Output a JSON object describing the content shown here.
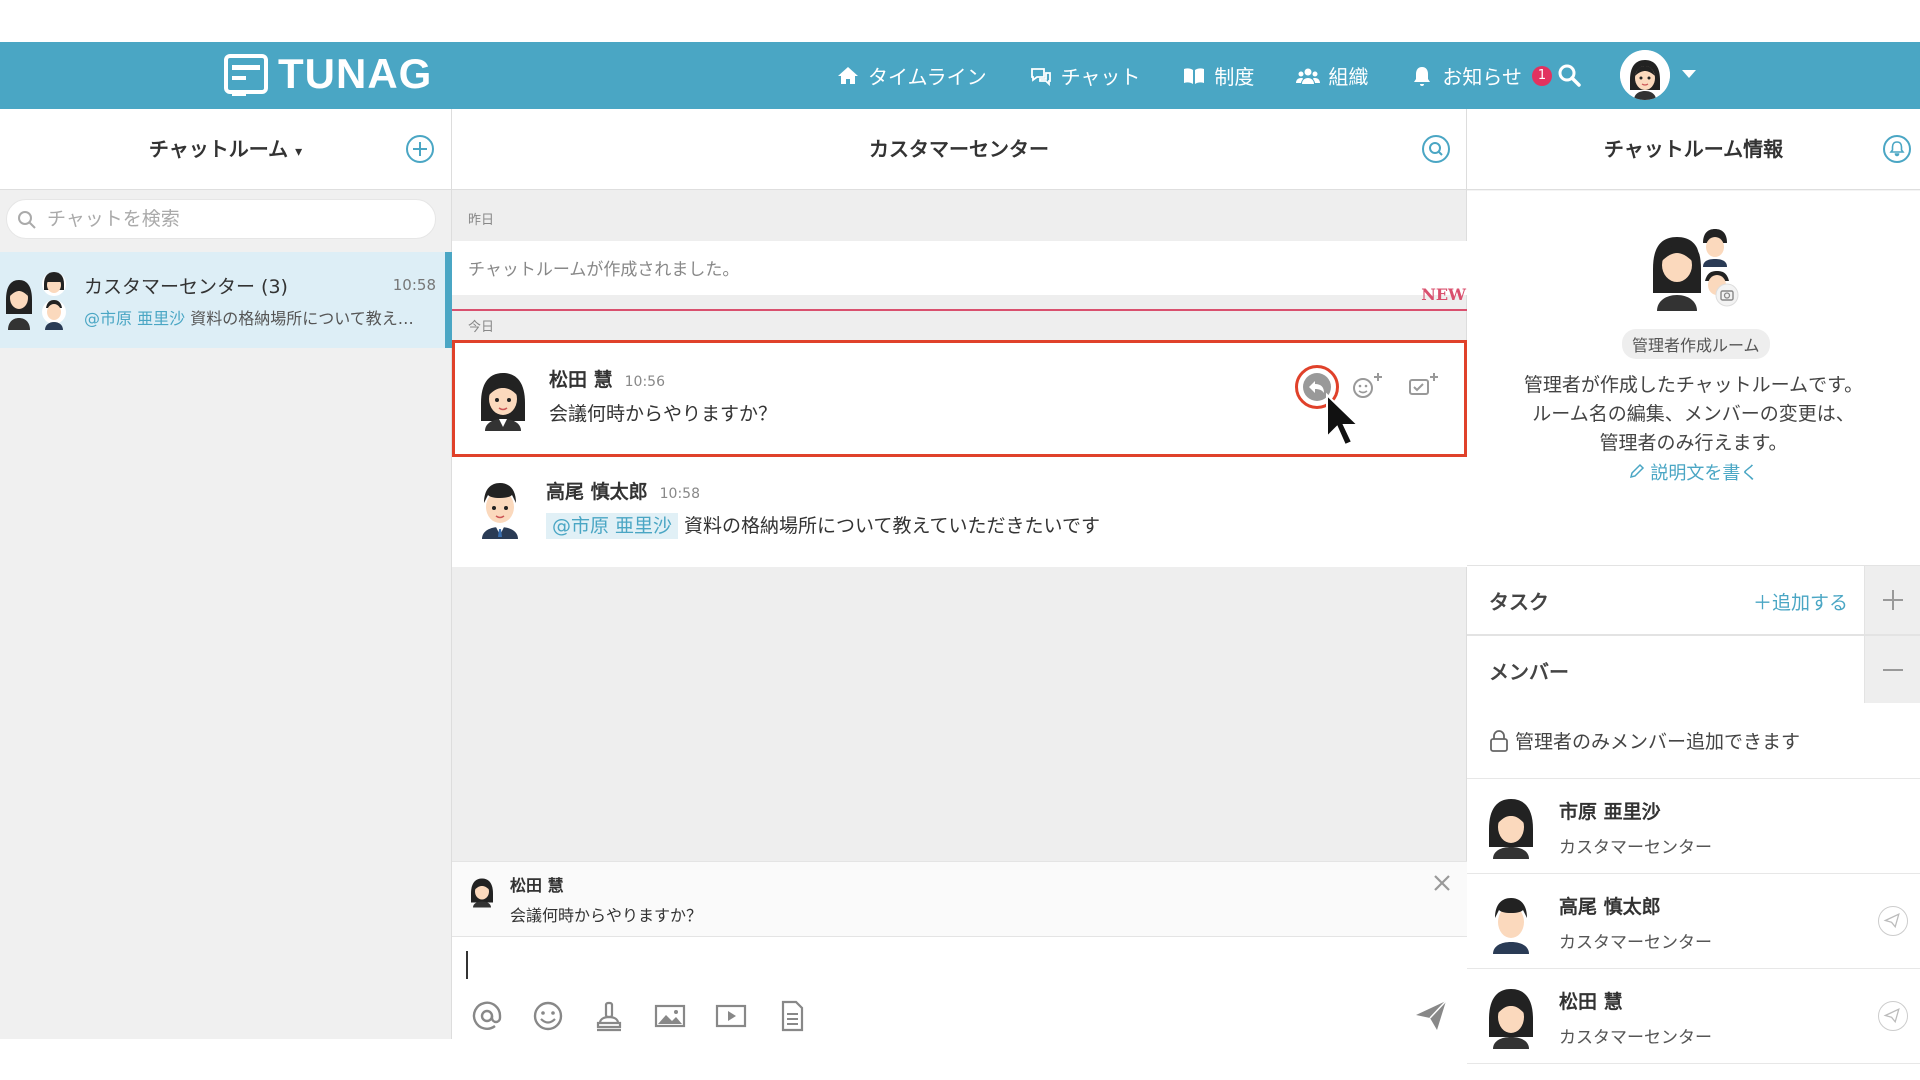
{
  "header": {
    "logo_text": "TUNAG",
    "nav": [
      {
        "label": "タイムライン",
        "icon": "home-icon"
      },
      {
        "label": "チャット",
        "icon": "chat-bubbles-icon"
      },
      {
        "label": "制度",
        "icon": "book-icon"
      },
      {
        "label": "組織",
        "icon": "people-icon"
      },
      {
        "label": "お知らせ",
        "icon": "bell-icon"
      }
    ],
    "notification_count": "1",
    "brand_color": "#4aa6c4"
  },
  "sidebar": {
    "title": "チャットルーム",
    "search_placeholder": "チャットを検索",
    "rooms": [
      {
        "name": "カスタマーセンター (3)",
        "time": "10:58",
        "mention": "@市原 亜里沙",
        "preview": "資料の格納場所について教え…"
      }
    ]
  },
  "chat": {
    "title": "カスタマーセンター",
    "yesterday_label": "昨日",
    "system_message": "チャットルームが作成されました。",
    "new_label": "NEW",
    "today_label": "今日",
    "messages": [
      {
        "name": "松田 慧",
        "time": "10:56",
        "text": "会議何時からやりますか？"
      },
      {
        "name": "高尾 慎太郎",
        "time": "10:58",
        "mention": "@市原 亜里沙",
        "text": "資料の格納場所について教えていただきたいです"
      }
    ],
    "reply_preview": {
      "name": "松田 慧",
      "text": "会議何時からやりますか？"
    },
    "highlight_color": "#e0412a"
  },
  "info": {
    "title": "チャットルーム情報",
    "room_type": "管理者作成ルーム",
    "description_lines": [
      "管理者が作成したチャットルームです。",
      "ルーム名の編集、メンバーの変更は、",
      "管理者のみ行えます。"
    ],
    "write_description": "説明文を書く",
    "tasks_label": "タスク",
    "add_task": "＋追加する",
    "members_label": "メンバー",
    "lock_notice": "管理者のみメンバー追加できます",
    "members": [
      {
        "name": "市原 亜里沙",
        "dept": "カスタマーセンター"
      },
      {
        "name": "高尾 慎太郎",
        "dept": "カスタマーセンター"
      },
      {
        "name": "松田 慧",
        "dept": "カスタマーセンター"
      }
    ]
  }
}
